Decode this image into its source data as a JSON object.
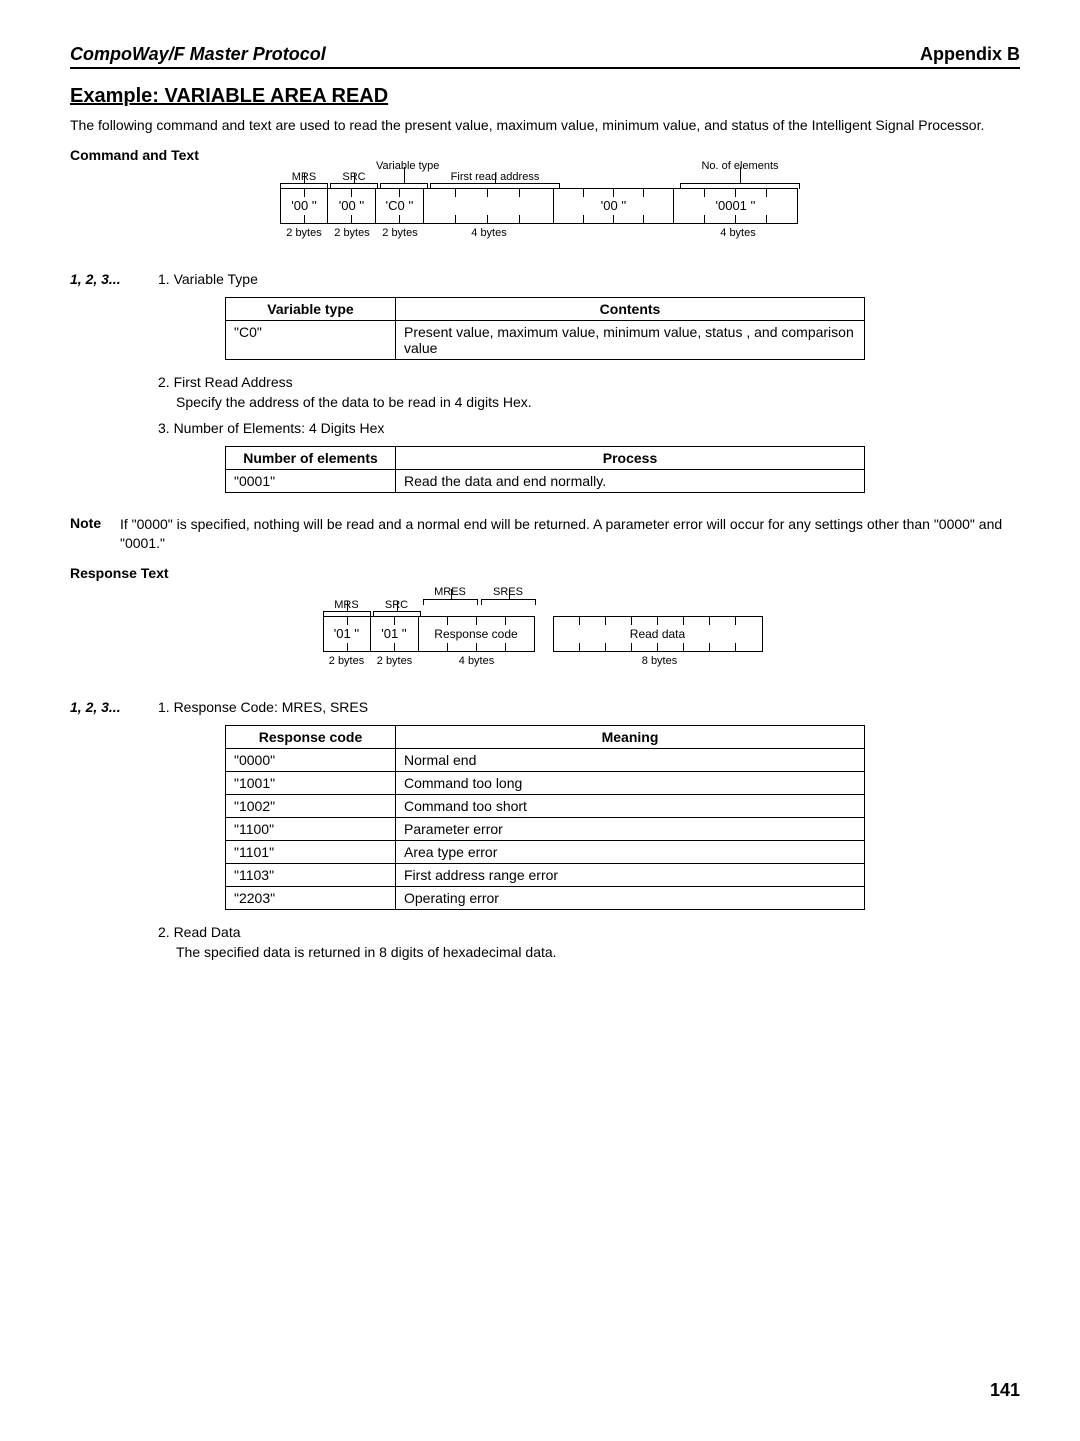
{
  "header": {
    "left": "CompoWay/F Master Protocol",
    "right": "Appendix B"
  },
  "section_title": "Example: VARIABLE AREA READ",
  "intro": "The following command and text are used to read the present value, maximum value, minimum value, and status of the Intelligent Signal Processor.",
  "cmd_text_label": "Command and Text",
  "steps_label": "1, 2, 3...",
  "diagram1": {
    "labels": {
      "mrs": "MRS",
      "src": "SRC",
      "vartype": "Variable type",
      "firstaddr": "First read address",
      "noelem": "No. of elements"
    },
    "cells": {
      "c1": "'00 ''",
      "c2": "'00 ''",
      "c3": "'C0 ''",
      "c4": "",
      "c5": "'00 ''",
      "c6": "'0001 ''"
    },
    "bytes": {
      "b1": "2 bytes",
      "b2": "2 bytes",
      "b3": "2 bytes",
      "b4": "4 bytes",
      "b6": "4 bytes"
    }
  },
  "step1": {
    "title": "1. Variable Type",
    "table": {
      "head": {
        "c1": "Variable type",
        "c2": "Contents"
      },
      "rows": [
        {
          "c1": "\"C0\"",
          "c2": "Present value, maximum value, minimum value, status , and comparison value"
        }
      ]
    }
  },
  "step2": {
    "title": "2. First Read Address",
    "sub": "Specify the address of the data to be read in 4 digits Hex."
  },
  "step3": {
    "title": "3. Number of Elements: 4 Digits Hex",
    "table": {
      "head": {
        "c1": "Number of elements",
        "c2": "Process"
      },
      "rows": [
        {
          "c1": "\"0001\"",
          "c2": "Read the data and end normally."
        }
      ]
    }
  },
  "note": {
    "label": "Note",
    "text": "If \"0000\" is specified, nothing will be read and a normal end will be returned. A parameter error will occur for any settings other than \"0000\" and \"0001.\""
  },
  "resp_text_label": "Response Text",
  "diagram2": {
    "labels": {
      "mrs": "MRS",
      "src": "SRC",
      "mres": "MRES",
      "sres": "SRES",
      "respcode": "Response code",
      "readdata": "Read data"
    },
    "cells": {
      "c1": "'01 ''",
      "c2": "'01 ''"
    },
    "bytes": {
      "b1": "2 bytes",
      "b2": "2 bytes",
      "b3": "4 bytes",
      "b4": "8 bytes"
    }
  },
  "stepR1": {
    "title": "1. Response Code: MRES, SRES",
    "table": {
      "head": {
        "c1": "Response code",
        "c2": "Meaning"
      },
      "rows": [
        {
          "c1": "\"0000\"",
          "c2": "Normal end"
        },
        {
          "c1": "\"1001\"",
          "c2": "Command too long"
        },
        {
          "c1": "\"1002\"",
          "c2": "Command too short"
        },
        {
          "c1": "\"1100\"",
          "c2": "Parameter error"
        },
        {
          "c1": "\"1101\"",
          "c2": "Area type error"
        },
        {
          "c1": "\"1103\"",
          "c2": "First address range error"
        },
        {
          "c1": "\"2203\"",
          "c2": "Operating error"
        }
      ]
    }
  },
  "stepR2": {
    "title": "2. Read Data",
    "sub": "The specified data is returned in 8 digits of hexadecimal data."
  },
  "pagenum": "141"
}
